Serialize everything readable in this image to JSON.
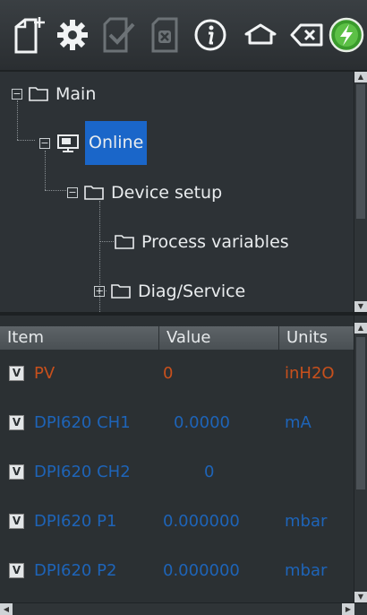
{
  "toolbar": {
    "buttons": [
      {
        "icon": "new-document-icon"
      },
      {
        "icon": "gear-icon"
      },
      {
        "icon": "check-document-icon",
        "disabled": true
      },
      {
        "icon": "cancel-document-icon",
        "disabled": true
      },
      {
        "icon": "info-icon"
      },
      {
        "icon": "home-icon"
      },
      {
        "icon": "backspace-icon"
      },
      {
        "icon": "power-icon"
      }
    ]
  },
  "tree": {
    "nodes": [
      {
        "label": "Main",
        "expander": "−"
      },
      {
        "label": "Online",
        "expander": "−"
      },
      {
        "label": "Device setup",
        "expander": "−"
      },
      {
        "label": "Process variables"
      },
      {
        "label": "Diag/Service",
        "expander": "+"
      }
    ]
  },
  "table": {
    "columns": [
      "Item",
      "Value",
      "Units"
    ],
    "badge": "V",
    "rows": [
      {
        "item": "PV",
        "value": "0",
        "units": "inH2O",
        "color": "#c8501c"
      },
      {
        "item": "DPI620 CH1",
        "value": "0.0000",
        "units": "mA",
        "color": "#1e64b8"
      },
      {
        "item": "DPI620 CH2",
        "value": "0",
        "units": "",
        "color": "#1e64b8"
      },
      {
        "item": "DPI620 P1",
        "value": "0.000000",
        "units": "mbar",
        "color": "#1e64b8"
      },
      {
        "item": "DPI620 P2",
        "value": "0.000000",
        "units": "mbar",
        "color": "#1e64b8"
      }
    ]
  },
  "colors": {
    "selection": "#1a66c9",
    "pv_text": "#c8501c",
    "var_text": "#1e64b8"
  }
}
